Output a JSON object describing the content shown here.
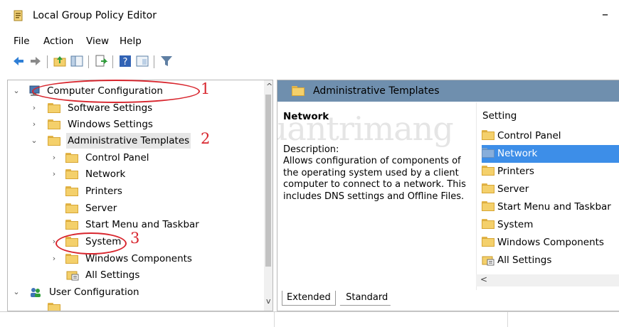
{
  "window": {
    "title": "Local Group Policy Editor",
    "minimize_glyph": "–"
  },
  "menu": [
    "File",
    "Action",
    "View",
    "Help"
  ],
  "toolbar": {
    "icons": [
      "back-arrow-icon",
      "forward-arrow-icon",
      "up-folder-icon",
      "show-hide-tree-icon",
      "export-list-icon",
      "help-icon",
      "properties-icon",
      "filter-icon"
    ]
  },
  "tree": {
    "scroll_up": "^",
    "scroll_down": "v",
    "items": [
      {
        "label": "Computer Configuration",
        "expanded": true
      },
      {
        "label": "Software Settings",
        "expanded": false
      },
      {
        "label": "Windows Settings",
        "expanded": false
      },
      {
        "label": "Administrative Templates",
        "expanded": true
      },
      {
        "label": "Control Panel",
        "expanded": false
      },
      {
        "label": "Network",
        "expanded": false
      },
      {
        "label": "Printers"
      },
      {
        "label": "Server"
      },
      {
        "label": "Start Menu and Taskbar"
      },
      {
        "label": "System",
        "expanded": false
      },
      {
        "label": "Windows Components",
        "expanded": false
      },
      {
        "label": "All Settings"
      },
      {
        "label": "User Configuration",
        "expanded": true
      }
    ]
  },
  "details": {
    "header_title": "Administrative Templates",
    "selected_title": "Network",
    "description_label": "Description:",
    "description_text": "Allows configuration of components of the operating system used by a client computer to connect to a network. This includes DNS settings and Offline Files.",
    "list_header": "Setting",
    "list_items": [
      "Control Panel",
      "Network",
      "Printers",
      "Server",
      "Start Menu and Taskbar",
      "System",
      "Windows Components",
      "All Settings"
    ],
    "selected_index": 1,
    "hscroll_left": "<",
    "tabs": [
      "Extended",
      "Standard"
    ],
    "active_tab": "Extended"
  },
  "annotations": {
    "one": "1",
    "two": "2",
    "three": "3",
    "color": "#d8262e"
  },
  "watermark": "Quantrimang",
  "colors": {
    "selection": "#3d8ee8",
    "header": "#6f8fae",
    "folder": "#f4d06b"
  }
}
